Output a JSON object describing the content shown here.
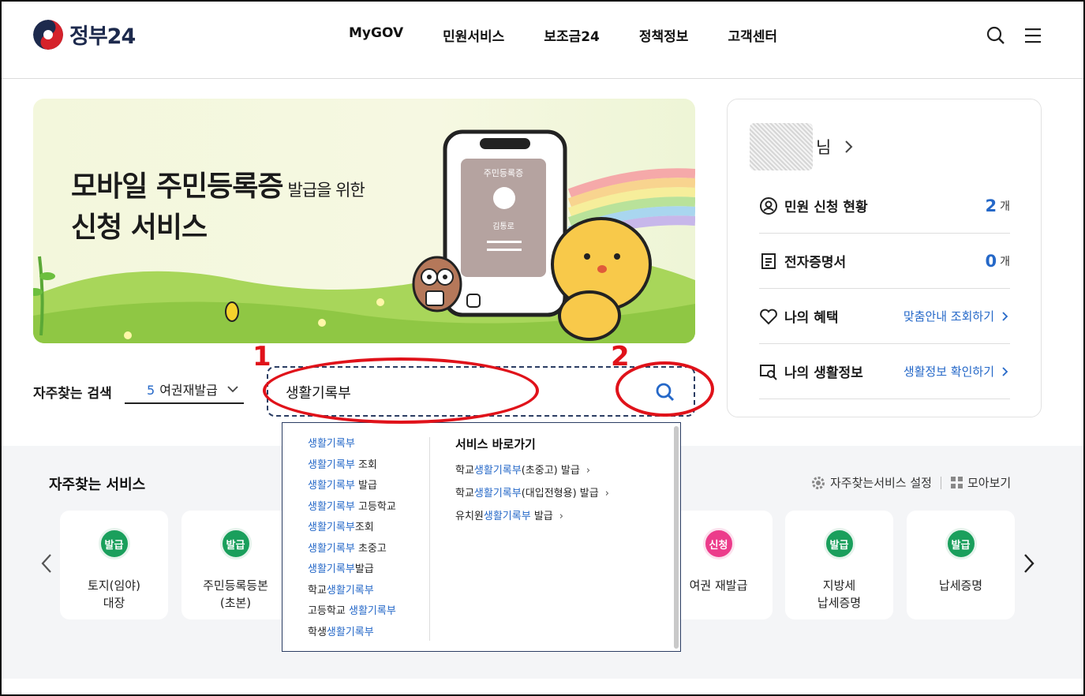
{
  "header": {
    "logo_text": "정부24",
    "nav": [
      "MyGOV",
      "민원서비스",
      "보조금24",
      "정책정보",
      "고객센터"
    ]
  },
  "banner": {
    "title_main": "모바일 주민등록증",
    "title_sub": "발급을 위한",
    "title_line2": "신청 서비스",
    "card_title": "주민등록증",
    "card_name": "김통로"
  },
  "profile": {
    "name_suffix": "님",
    "rows": [
      {
        "label": "민원 신청 현황",
        "count": "2",
        "unit": "개"
      },
      {
        "label": "전자증명서",
        "count": "0",
        "unit": "개"
      },
      {
        "label": "나의 혜택",
        "link": "맞춤안내 조회하기"
      },
      {
        "label": "나의 생활정보",
        "link": "생활정보 확인하기"
      }
    ]
  },
  "search": {
    "freq_label": "자주찾는 검색",
    "freq_num": "5",
    "freq_value": "여권재발급",
    "query": "생활기록부"
  },
  "annotations": {
    "one": "1",
    "two": "2"
  },
  "autocomplete": {
    "suggestions": [
      {
        "pre": "",
        "hl": "생활기록부",
        "post": ""
      },
      {
        "pre": "",
        "hl": "생활기록부",
        "post": " 조회"
      },
      {
        "pre": "",
        "hl": "생활기록부",
        "post": " 발급"
      },
      {
        "pre": "",
        "hl": "생활기록부",
        "post": " 고등학교"
      },
      {
        "pre": "",
        "hl": "생활기록부",
        "post": "조회"
      },
      {
        "pre": "",
        "hl": "생활기록부",
        "post": " 초중고"
      },
      {
        "pre": "",
        "hl": "생활기록부",
        "post": "발급"
      },
      {
        "pre": "학교",
        "hl": "생활기록부",
        "post": ""
      },
      {
        "pre": "고등학교 ",
        "hl": "생활기록부",
        "post": ""
      },
      {
        "pre": "학생",
        "hl": "생활기록부",
        "post": ""
      }
    ],
    "quick_heading": "서비스 바로가기",
    "quick_links": [
      {
        "pre": "학교",
        "hl": "생활기록부",
        "post": "(초중고) 발급"
      },
      {
        "pre": "학교",
        "hl": "생활기록부",
        "post": "(대입전형용) 발급"
      },
      {
        "pre": "유치원",
        "hl": "생활기록부",
        "post": " 발급"
      }
    ]
  },
  "services": {
    "title": "자주찾는 서비스",
    "settings_label": "자주찾는서비스 설정",
    "all_label": "모아보기",
    "cards": [
      {
        "badge": "발급",
        "color": "green",
        "label": "토지(임야)\n대장"
      },
      {
        "badge": "발급",
        "color": "green",
        "label": "주민등록등본\n(초본)"
      },
      {
        "badge": "신청",
        "color": "pink",
        "label": "여권 재발급"
      },
      {
        "badge": "발급",
        "color": "green",
        "label": "지방세\n납세증명"
      },
      {
        "badge": "발급",
        "color": "green",
        "label": "납세증명"
      }
    ]
  },
  "colors": {
    "accent": "#2568c8",
    "annotation": "#e0121a",
    "badge_green": "#1a9f5c",
    "badge_pink": "#ec3c8b"
  }
}
